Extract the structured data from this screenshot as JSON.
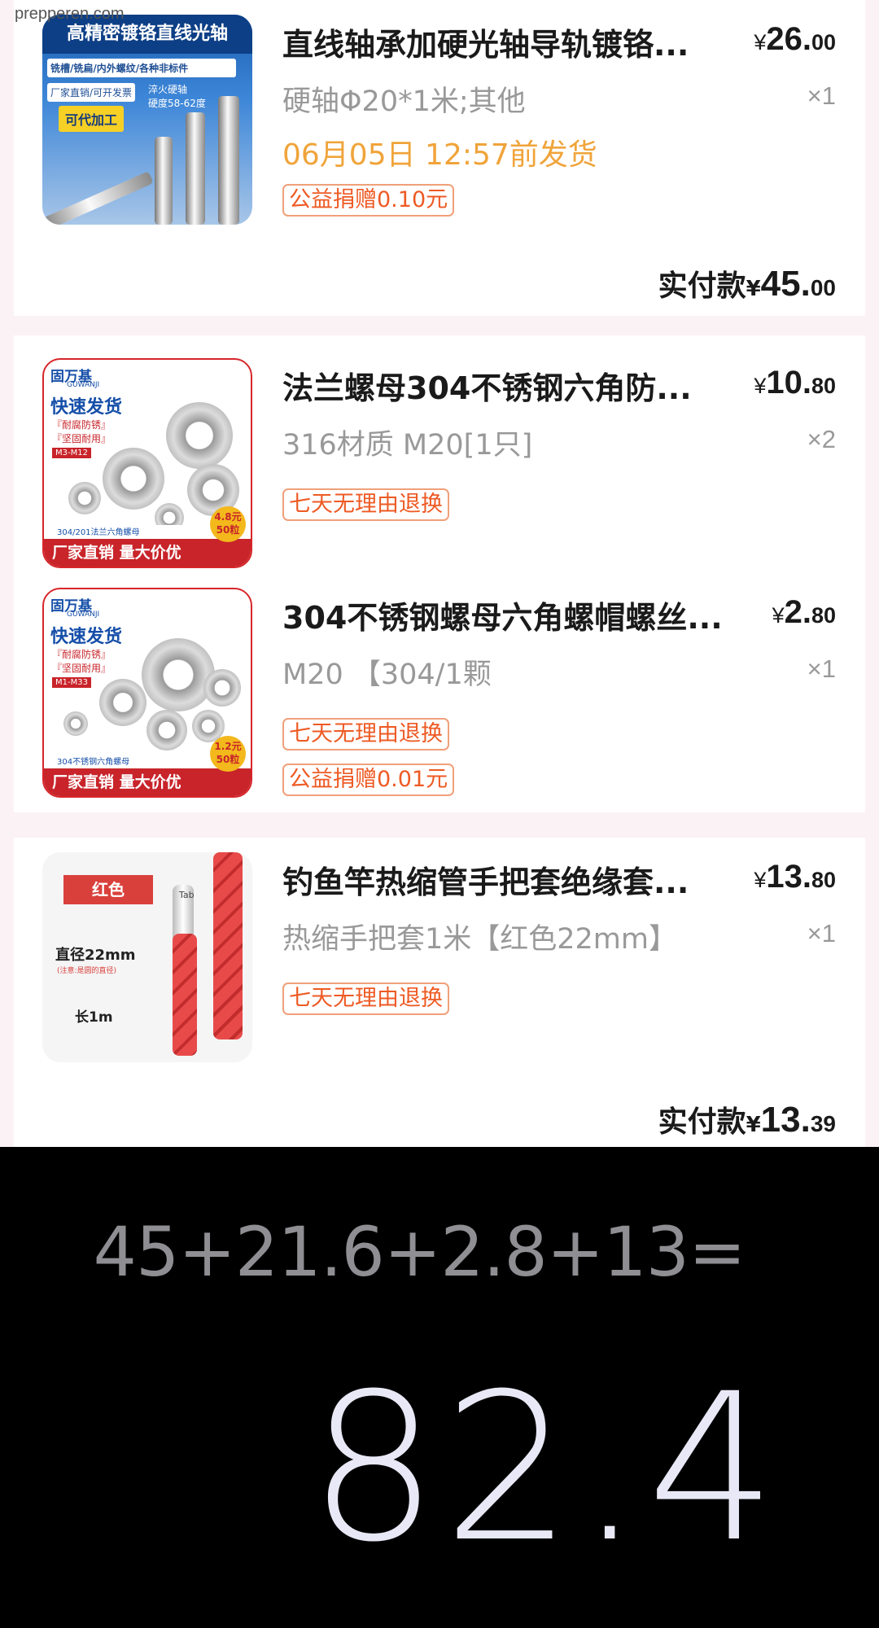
{
  "watermark": "prepperen.com",
  "orders": [
    {
      "items": [
        {
          "title": "直线轴承加硬光轴导轨镀铬...",
          "spec": "硬轴Φ20*1米;其他",
          "price": {
            "currency": "¥",
            "int": "26.",
            "dec": "00"
          },
          "qty": "×1",
          "ship": "06月05日 12:57前发货",
          "tags": [
            "公益捐赠0.10元"
          ],
          "thumb": {
            "header": "高精密镀铬直线光轴",
            "strip": "铣槽/铣扁/内外螺纹/各种非标件",
            "tag1": "厂家直销/可开发票",
            "tag2": "可代加工",
            "note": [
              "淬火硬轴",
              "硬度58-62度"
            ]
          }
        }
      ],
      "paid": {
        "label": "实付款",
        "currency": "¥",
        "int": "45.",
        "dec": "00"
      }
    },
    {
      "items": [
        {
          "title": "法兰螺母304不锈钢六角防...",
          "spec": "316材质  M20[1只]",
          "price": {
            "currency": "¥",
            "int": "10.",
            "dec": "80"
          },
          "qty": "×2",
          "tags": [
            "七天无理由退换"
          ],
          "thumb": {
            "brand": "固万基",
            "brand_sub": "GUWANJI",
            "fast": "快速发货",
            "feat": [
              "『耐腐防锈』",
              "『坚固耐用』"
            ],
            "msize": "M3-M12",
            "caption": "304/201法兰六角螺母",
            "bar": "厂家直销  量大价优",
            "badge": [
              "4.8元",
              "50粒"
            ]
          }
        },
        {
          "title": "304不锈钢螺母六角螺帽螺丝...",
          "spec": "M20 【304/1颗",
          "price": {
            "currency": "¥",
            "int": "2.",
            "dec": "80"
          },
          "qty": "×1",
          "tags": [
            "七天无理由退换",
            "公益捐赠0.01元"
          ],
          "thumb": {
            "brand": "固万基",
            "brand_sub": "GUWANJI",
            "fast": "快速发货",
            "feat": [
              "『耐腐防锈』",
              "『坚固耐用』"
            ],
            "msize": "M1-M33",
            "caption": "304不锈钢六角螺母",
            "bar": "厂家直销  量大价优",
            "badge": [
              "1.2元",
              "50粒"
            ]
          }
        }
      ]
    },
    {
      "items": [
        {
          "title": "钓鱼竿热缩管手把套绝缘套...",
          "spec": "热缩手把套1米【红色22mm】",
          "price": {
            "currency": "¥",
            "int": "13.",
            "dec": "80"
          },
          "qty": "×1",
          "tags": [
            "七天无理由退换"
          ],
          "thumb": {
            "color": "红色",
            "diameter": "直径22mm",
            "diameter_note": "(注意:是圆的直径)",
            "length": "长1m",
            "tab": "Tab"
          }
        }
      ],
      "paid": {
        "label": "实付款",
        "currency": "¥",
        "int": "13.",
        "dec": "39"
      }
    }
  ],
  "calculator": {
    "expression": "45+21.6+2.8+13=",
    "result": "82.4"
  }
}
